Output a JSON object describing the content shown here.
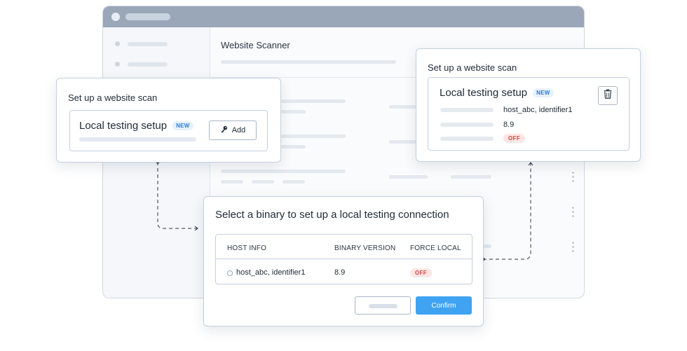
{
  "background_app": {
    "title": "Website Scanner"
  },
  "left_card": {
    "title": "Set up a website scan",
    "setup_title": "Local testing setup",
    "badge": "NEW",
    "add_button_label": "Add",
    "add_icon": "key-icon"
  },
  "right_card": {
    "title": "Set up a website scan",
    "setup_title": "Local testing setup",
    "badge": "NEW",
    "host_info": "host_abc, identifier1",
    "binary_version": "8.9",
    "force_local": "OFF",
    "delete_icon": "trash-icon"
  },
  "binary_dialog": {
    "title": "Select a binary to set up a local testing connection",
    "columns": [
      "HOST INFO",
      "BINARY VERSION",
      "FORCE LOCAL"
    ],
    "rows": [
      {
        "host_info": "host_abc, identifier1",
        "binary_version": "8.9",
        "force_local": "OFF"
      }
    ],
    "confirm_label": "Confirm"
  },
  "colors": {
    "accent": "#3fa3f2",
    "badge_new": "#2c7cd6",
    "badge_off": "#d0463f",
    "titlebar": "#9aa7b8"
  }
}
